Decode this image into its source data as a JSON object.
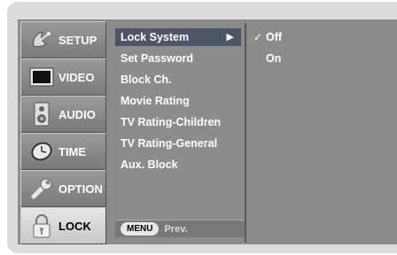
{
  "sidebar": {
    "items": [
      {
        "label": "SETUP",
        "icon": "satellite-dish-icon"
      },
      {
        "label": "VIDEO",
        "icon": "tv-screen-icon"
      },
      {
        "label": "AUDIO",
        "icon": "speaker-icon"
      },
      {
        "label": "TIME",
        "icon": "clock-icon"
      },
      {
        "label": "OPTION",
        "icon": "wrench-icon"
      },
      {
        "label": "LOCK",
        "icon": "padlock-icon",
        "active": true
      }
    ]
  },
  "menu": {
    "items": [
      {
        "label": "Lock System",
        "selected": true,
        "arrow": "▶"
      },
      {
        "label": "Set Password"
      },
      {
        "label": "Block Ch."
      },
      {
        "label": "Movie Rating"
      },
      {
        "label": "TV Rating-Children"
      },
      {
        "label": "TV Rating-General"
      },
      {
        "label": "Aux. Block"
      }
    ],
    "footer": {
      "key_label": "MENU",
      "action_label": "Prev."
    }
  },
  "options": {
    "items": [
      {
        "label": "Off",
        "check": "✓",
        "checked": true
      },
      {
        "label": "On",
        "check": "",
        "checked": false
      }
    ]
  },
  "colors": {
    "menu_bg": "#8c8c8c",
    "highlight": "#4d5666",
    "active_tab": "#d8d8d8"
  }
}
